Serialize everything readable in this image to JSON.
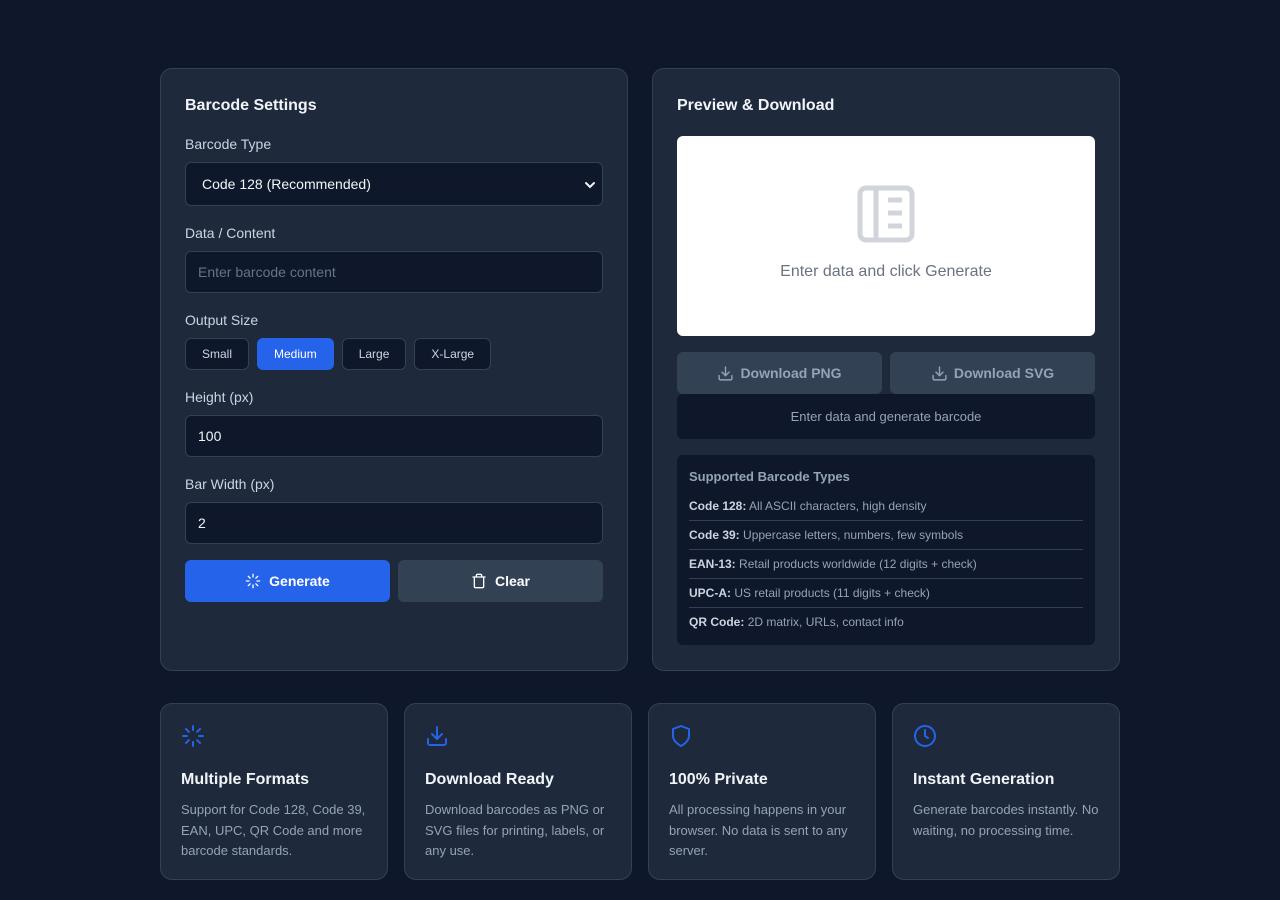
{
  "settings": {
    "title": "Barcode Settings",
    "type_label": "Barcode Type",
    "type_value": "Code 128 (Recommended)",
    "data_label": "Data / Content",
    "data_placeholder": "Enter barcode content",
    "size_label": "Output Size",
    "sizes": [
      {
        "label": "Small",
        "active": false
      },
      {
        "label": "Medium",
        "active": true
      },
      {
        "label": "Large",
        "active": false
      },
      {
        "label": "X-Large",
        "active": false
      }
    ],
    "height_label": "Height (px)",
    "height_value": "100",
    "barwidth_label": "Bar Width (px)",
    "barwidth_value": "2",
    "generate_label": "Generate",
    "clear_label": "Clear"
  },
  "preview": {
    "title": "Preview & Download",
    "empty_text": "Enter data and click Generate",
    "download_png_label": "Download PNG",
    "download_svg_label": "Download SVG",
    "status_text": "Enter data and generate barcode",
    "types_title": "Supported Barcode Types",
    "types": [
      {
        "name": "Code 128:",
        "desc": "All ASCII characters, high density"
      },
      {
        "name": "Code 39:",
        "desc": "Uppercase letters, numbers, few symbols"
      },
      {
        "name": "EAN-13:",
        "desc": "Retail products worldwide (12 digits + check)"
      },
      {
        "name": "UPC-A:",
        "desc": "US retail products (11 digits + check)"
      },
      {
        "name": "QR Code:",
        "desc": "2D matrix, URLs, contact info"
      }
    ]
  },
  "features": [
    {
      "icon": "loader-icon",
      "title": "Multiple Formats",
      "desc": "Support for Code 128, Code 39, EAN, UPC, QR Code and more barcode standards."
    },
    {
      "icon": "download-icon",
      "title": "Download Ready",
      "desc": "Download barcodes as PNG or SVG files for printing, labels, or any use."
    },
    {
      "icon": "shield-icon",
      "title": "100% Private",
      "desc": "All processing happens in your browser. No data is sent to any server."
    },
    {
      "icon": "clock-icon",
      "title": "Instant Generation",
      "desc": "Generate barcodes instantly. No waiting, no processing time."
    }
  ],
  "colors": {
    "accent": "#2563eb",
    "background": "#0f172a",
    "panel": "#1e293b",
    "border": "#334155"
  }
}
